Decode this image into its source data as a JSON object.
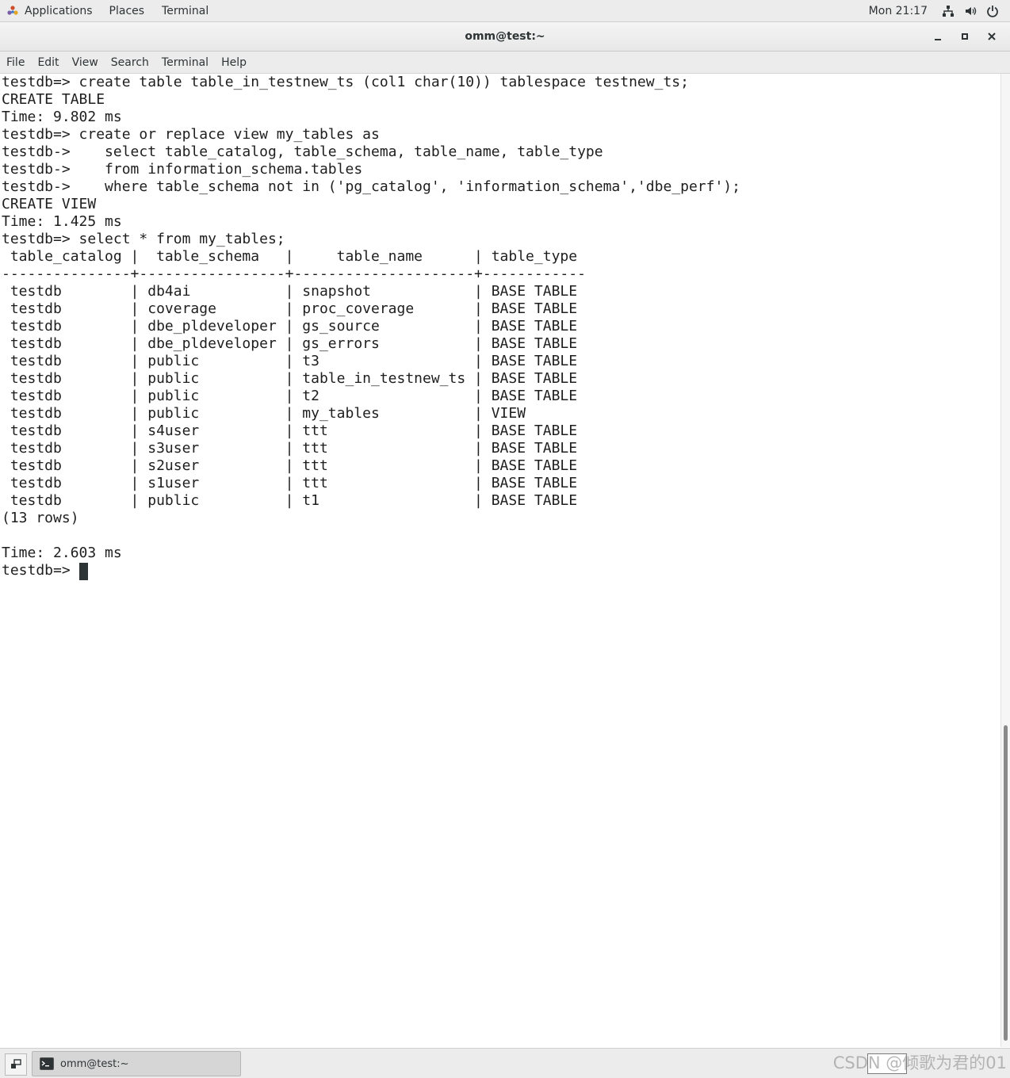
{
  "topbar": {
    "applications": "Applications",
    "places": "Places",
    "terminal": "Terminal",
    "clock": "Mon 21:17",
    "icons": [
      "network-icon",
      "volume-icon",
      "power-icon"
    ]
  },
  "window": {
    "title": "omm@test:~",
    "buttons": [
      "minimize",
      "maximize",
      "close"
    ]
  },
  "menubar": {
    "items": [
      "File",
      "Edit",
      "View",
      "Search",
      "Terminal",
      "Help"
    ]
  },
  "terminal": {
    "lines": [
      "testdb=> create table table_in_testnew_ts (col1 char(10)) tablespace testnew_ts;",
      "CREATE TABLE",
      "Time: 9.802 ms",
      "testdb=> create or replace view my_tables as",
      "testdb->    select table_catalog, table_schema, table_name, table_type",
      "testdb->    from information_schema.tables",
      "testdb->    where table_schema not in ('pg_catalog', 'information_schema','dbe_perf');",
      "CREATE VIEW",
      "Time: 1.425 ms",
      "testdb=> select * from my_tables;",
      " table_catalog |  table_schema   |     table_name      | table_type",
      "---------------+-----------------+---------------------+------------",
      " testdb        | db4ai           | snapshot            | BASE TABLE",
      " testdb        | coverage        | proc_coverage       | BASE TABLE",
      " testdb        | dbe_pldeveloper | gs_source           | BASE TABLE",
      " testdb        | dbe_pldeveloper | gs_errors           | BASE TABLE",
      " testdb        | public          | t3                  | BASE TABLE",
      " testdb        | public          | table_in_testnew_ts | BASE TABLE",
      " testdb        | public          | t2                  | BASE TABLE",
      " testdb        | public          | my_tables           | VIEW",
      " testdb        | s4user          | ttt                 | BASE TABLE",
      " testdb        | s3user          | ttt                 | BASE TABLE",
      " testdb        | s2user          | ttt                 | BASE TABLE",
      " testdb        | s1user          | ttt                 | BASE TABLE",
      " testdb        | public          | t1                  | BASE TABLE",
      "(13 rows)",
      "",
      "Time: 2.603 ms",
      "testdb=> "
    ]
  },
  "taskbar": {
    "task_label": "omm@test:~",
    "watermark": "CSDN @倾歌为君的01"
  }
}
